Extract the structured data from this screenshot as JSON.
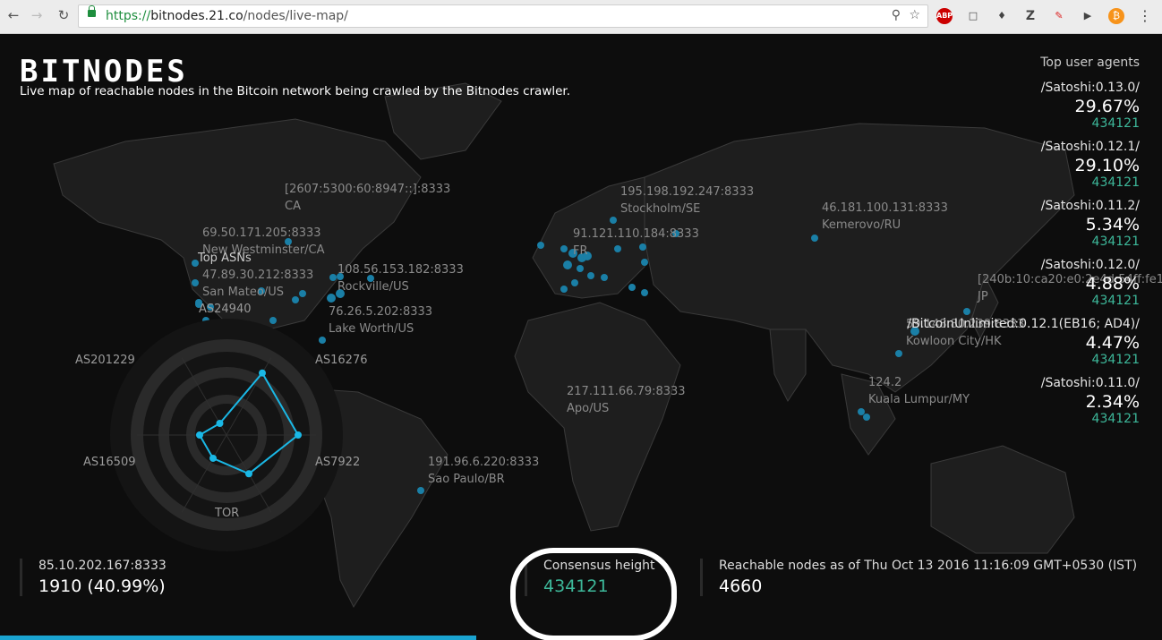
{
  "browser": {
    "url_scheme": "https://",
    "url_host": "bitnodes.21.co",
    "url_path": "/nodes/live-map/",
    "extensions": [
      "ABP",
      "pocket",
      "evernote",
      "Z",
      "pen",
      "audio",
      "bitcoin"
    ]
  },
  "header": {
    "logo": "BITNODES",
    "tagline": "Live map of reachable nodes in the Bitcoin network being crawled by the Bitnodes crawler."
  },
  "map_labels": [
    {
      "addr": "[2607:5300:60:8947::]:8333",
      "loc": "CA"
    },
    {
      "addr": "69.50.171.205:8333",
      "loc": "New Westminster/CA"
    },
    {
      "addr": "47.89.30.212:8333",
      "loc": "San Mateo/US"
    },
    {
      "addr": "108.56.153.182:8333",
      "loc": "Rockville/US"
    },
    {
      "addr": "76.26.5.202:8333",
      "loc": "Lake Worth/US"
    },
    {
      "addr": "195.198.192.247:8333",
      "loc": "Stockholm/SE"
    },
    {
      "addr": "91.121.110.184:8333",
      "loc": "FR"
    },
    {
      "addr": "46.181.100.131:8333",
      "loc": "Kemerovo/RU"
    },
    {
      "addr": "[240b:10:ca20:e0:2e4d:54ff:fe1",
      "loc": "JP"
    },
    {
      "addr": "59.148.80.239:8333",
      "loc": "Kowloon City/HK"
    },
    {
      "addr": "124.2",
      "loc": "Kuala Lumpur/MY"
    },
    {
      "addr": "217.111.66.79:8333",
      "loc": "Apo/US"
    },
    {
      "addr": "191.96.6.220:8333",
      "loc": "Sao Paulo/BR"
    }
  ],
  "asn_radar": {
    "title": "Top ASNs",
    "axes": [
      "AS24940",
      "AS16276",
      "AS7922",
      "TOR",
      "AS16509",
      "AS201229"
    ],
    "values": [
      0.8,
      0.8,
      0.5,
      0.3,
      0.3,
      0.15
    ]
  },
  "agents": {
    "title": "Top user agents",
    "items": [
      {
        "name": "/Satoshi:0.13.0/",
        "pct": "29.67%",
        "height": "434121"
      },
      {
        "name": "/Satoshi:0.12.1/",
        "pct": "29.10%",
        "height": "434121"
      },
      {
        "name": "/Satoshi:0.11.2/",
        "pct": "5.34%",
        "height": "434121"
      },
      {
        "name": "/Satoshi:0.12.0/",
        "pct": "4.88%",
        "height": "434121"
      },
      {
        "name": "/BitcoinUnlimited:0.12.1(EB16; AD4)/",
        "pct": "4.47%",
        "height": "434121"
      },
      {
        "name": "/Satoshi:0.11.0/",
        "pct": "2.34%",
        "height": "434121"
      }
    ]
  },
  "footer": {
    "node_label": "85.10.202.167:8333",
    "node_value": "1910 (40.99%)",
    "consensus_label": "Consensus height",
    "consensus_value": "434121",
    "reachable_label": "Reachable nodes as of Thu Oct 13 2016 11:16:09 GMT+0530 (IST)",
    "reachable_value": "4660"
  },
  "crawl_progress": 0.41,
  "colors": {
    "node": "#1a7fa6",
    "accent": "#1ab8e6",
    "height_green": "#3db89a"
  }
}
